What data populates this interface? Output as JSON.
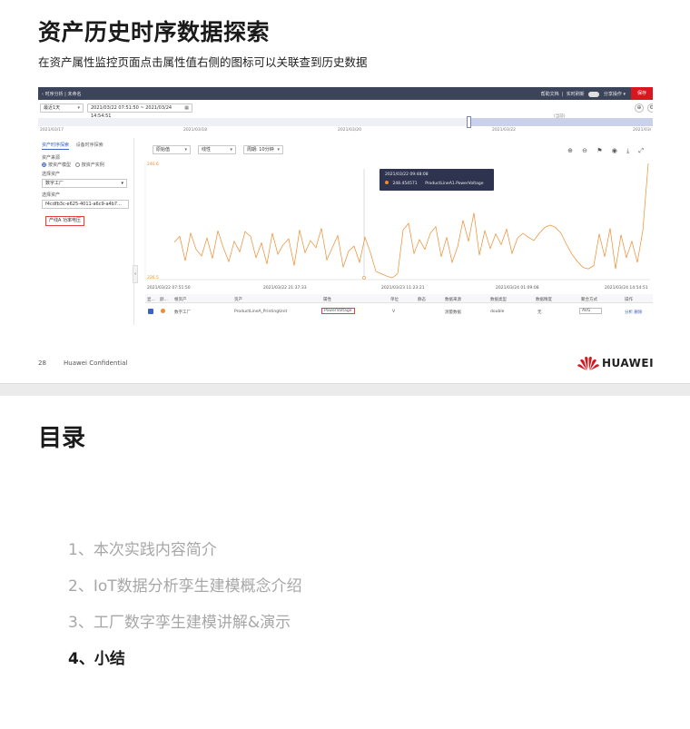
{
  "slide1": {
    "title": "资产历史时序数据探索",
    "subtitle": "在资产属性监控页面点击属性值右侧的图标可以关联查到历史数据",
    "page_number": "28",
    "confidential": "Huawei Confidential",
    "logo_text": "HUAWEI",
    "colors": {
      "brand_red": "#d9161f",
      "series_orange": "#f08a2c",
      "topbar": "#3c4459"
    }
  },
  "screenshot": {
    "topbar": {
      "breadcrumb": "‹  时序分析 | 未命名",
      "help": "帮助文档",
      "realtime": "实时刷新",
      "share": "分享操作 ▾",
      "save": "保存"
    },
    "filter": {
      "range_select": "最近1天",
      "time_range": "2021/03/22 07:51:50 ~ 2021/03/24 14:54:51"
    },
    "timeline": {
      "now_label": "(当前)",
      "ticks": [
        "2021/03/17",
        "2021/03/18",
        "2021/03/20",
        "2021/03/22",
        "2021/03/"
      ]
    },
    "left_panel": {
      "tab_active": "资产时序探索",
      "tab_other": "设备时序探索",
      "source_label": "资产来源",
      "radio_1": "按资产模型",
      "radio_2": "按资产实例",
      "select_asset_label": "选择资产",
      "select_asset_value": "数字工厂",
      "select_property_label": "选择资产",
      "search_value": "f4cdfb3c-e625-4011-a6c9-a4b7...",
      "tag": "产线A 功率电压"
    },
    "chart_toolbar": {
      "agg_select": "原始值",
      "interp_select": "线性",
      "interval_select": "周期: 10分钟",
      "tools": "⊕ ⊖ ⚑ ◉ ⤓ ⤢"
    },
    "tooltip": {
      "date": "2021/03/22 09:48:08",
      "value": "248.454571",
      "name": "ProductLineA1.PowerVoltage"
    },
    "x_labels": [
      "2021/03/22 07:51:50",
      "2021/03/22 21:37:33",
      "2021/03/23 11:23:21",
      "2021/03/24 01:09:08",
      "2021/03/24 14:54:51"
    ],
    "table": {
      "headers": [
        "显...",
        "颜...",
        "根资产",
        "资产",
        "属性",
        "单位",
        "静态",
        "数据来源",
        "数据类型",
        "数据精度",
        "聚合方式",
        "操作"
      ],
      "row": {
        "root_asset": "数字工厂",
        "asset": "ProductLineA_PrintingUnit",
        "property": "PowerVoltage",
        "unit": "V",
        "source": "测量数据",
        "type": "double",
        "precision": "无",
        "aggregation": "AVG",
        "actions": "分析  删除"
      }
    }
  },
  "chart_data": {
    "type": "line",
    "ylabel": "",
    "xlabel": "",
    "ytick_top": "240.6",
    "ytick_bottom": "226.5",
    "ylim": [
      226.5,
      240.6
    ],
    "x_range": [
      "2021/03/22 07:51:50",
      "2021/03/24 14:54:51"
    ],
    "series": [
      {
        "values": [
          230.9,
          231.6,
          228.6,
          232.0,
          230.0,
          229.2,
          231.4,
          228.9,
          232.3,
          230.2,
          228.5,
          231.0,
          229.7,
          232.2,
          231.6,
          229.0,
          230.8,
          228.2,
          232.0,
          229.4,
          230.6,
          231.3,
          228.0,
          232.4,
          229.6,
          231.1,
          230.2,
          232.6,
          228.7,
          230.2,
          231.7,
          227.8,
          229.8,
          230.4,
          228.4,
          231.5,
          229.6,
          227.3,
          227.0,
          226.7,
          226.5,
          227.0,
          232.4,
          233.2,
          229.5,
          231.2,
          230.0,
          232.0,
          232.8,
          229.1,
          231.5,
          228.4,
          230.3,
          233.6,
          231.0,
          234.5,
          229.3,
          232.3,
          230.1,
          231.9,
          230.6,
          232.5,
          229.5,
          231.4,
          232.0,
          231.5,
          231.1,
          232.0,
          232.7,
          233.0,
          232.7,
          232.0,
          230.6,
          229.4,
          228.5,
          227.8,
          227.6,
          228.0,
          231.9,
          229.1,
          232.6,
          227.6,
          231.8,
          229.0,
          231.0,
          228.4,
          232.3,
          240.6
        ]
      }
    ]
  },
  "slide2": {
    "title": "目录",
    "items": [
      "1、本次实践内容简介",
      "2、IoT数据分析孪生建模概念介绍",
      "3、工厂数字孪生建模讲解&演示",
      "4、小结"
    ]
  }
}
